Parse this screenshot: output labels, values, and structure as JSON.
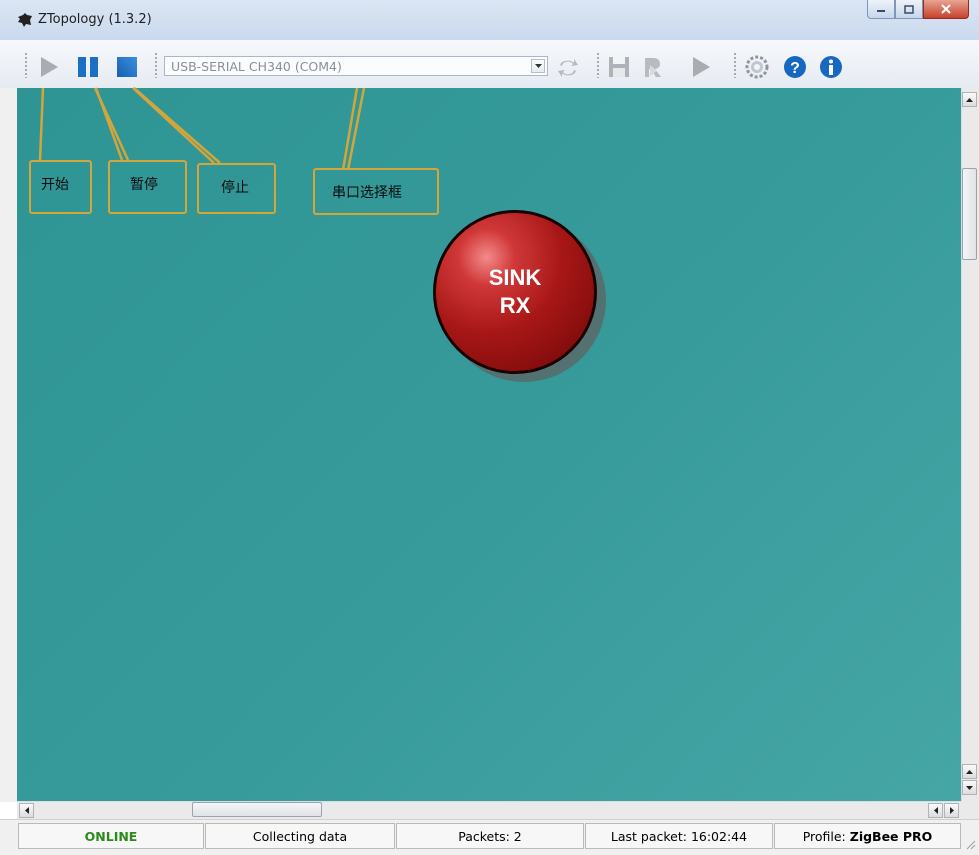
{
  "window": {
    "title": "ZTopology (1.3.2)",
    "app_icon": "ti-logo-icon"
  },
  "toolbar": {
    "serial_port_value": "USB-SERIAL CH340 (COM4)",
    "icons": [
      "play-icon",
      "pause-icon",
      "stop-icon",
      "refresh-icon",
      "save-icon",
      "replay-icon",
      "run-icon",
      "settings-icon",
      "help-icon",
      "info-icon"
    ]
  },
  "annotations": {
    "start": "开始",
    "pause": "暂停",
    "stop": "停止",
    "port_selector": "串口选择框",
    "color": "#d4a53a"
  },
  "node": {
    "line1": "SINK",
    "line2": "RX",
    "color": "#a81717"
  },
  "canvas": {
    "background": "#389b9b"
  },
  "status": {
    "connection": "ONLINE",
    "state": "Collecting data",
    "packets": "Packets: 2",
    "last_packet": "Last packet: 16:02:44",
    "profile_label": "Profile: ",
    "profile_value": "ZigBee PRO",
    "online_color": "#2a8a1a"
  }
}
